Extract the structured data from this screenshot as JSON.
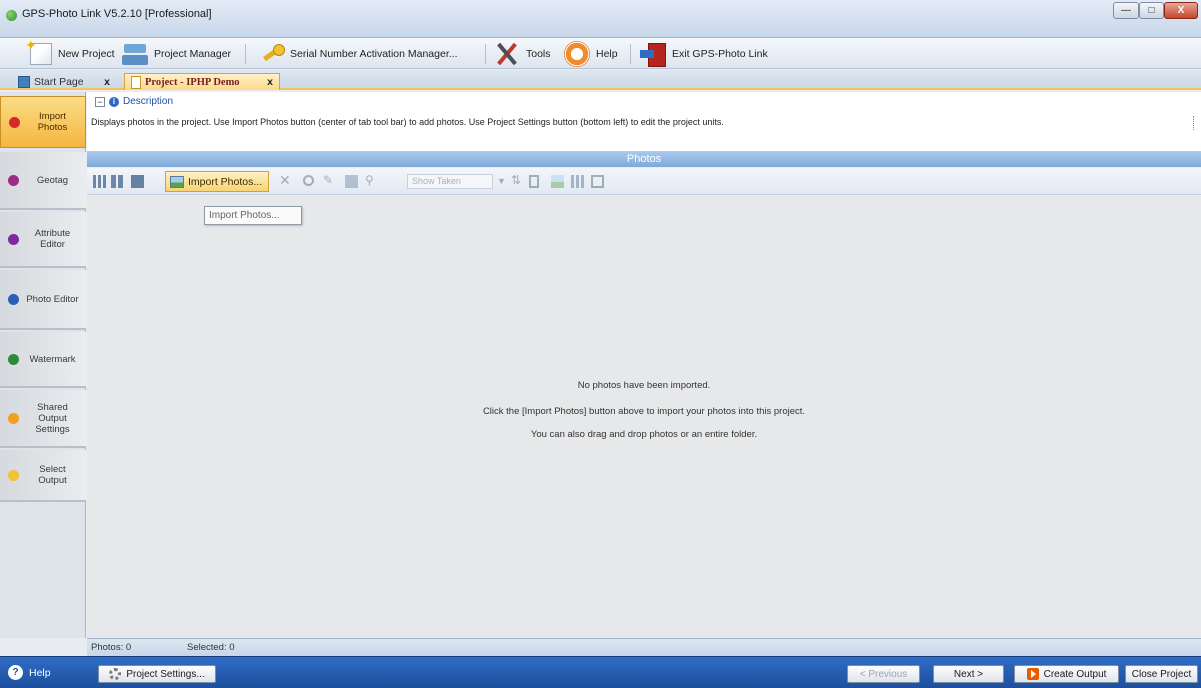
{
  "window": {
    "title": "GPS-Photo Link V5.2.10 [Professional]",
    "controls": {
      "minimize": "—",
      "maximize": "□",
      "close": "X"
    }
  },
  "toolbar": {
    "new_project": "New Project",
    "project_manager": "Project Manager",
    "serial_manager": "Serial Number Activation Manager...",
    "tools": "Tools",
    "help": "Help",
    "exit": "Exit GPS-Photo Link"
  },
  "tabs": {
    "start_page": "Start Page",
    "project": "Project - IPHP Demo",
    "close_glyph": "x"
  },
  "sidenav": {
    "items": [
      {
        "label": "Import Photos",
        "color": "#d8282a",
        "active": true
      },
      {
        "label": "Geotag",
        "color": "#9c2b86"
      },
      {
        "label": "Attribute Editor",
        "color": "#7b2aa0"
      },
      {
        "label": "Photo Editor",
        "color": "#2a5fb8"
      },
      {
        "label": "Watermark",
        "color": "#2e8a3a"
      },
      {
        "label": "Shared Output Settings",
        "color": "#f0a020"
      },
      {
        "label": "Select Output",
        "color": "#f2c230"
      }
    ]
  },
  "description": {
    "header": "Description",
    "collapse": "−",
    "info": "i",
    "text": "Displays photos in the project. Use Import Photos button (center of tab tool bar) to add photos. Use Project Settings button (bottom left) to edit the project units."
  },
  "photos": {
    "header": "Photos",
    "import_button": "Import Photos...",
    "tooltip": "Import Photos...",
    "filter_placeholder": "Show Taken",
    "empty": {
      "line1": "No photos have been imported.",
      "line2": "Click the [Import Photos] button above to import your photos into this project.",
      "line3": "You can also drag and drop photos or an entire folder."
    }
  },
  "status": {
    "photos": "Photos: 0",
    "selected": "Selected: 0"
  },
  "bottom": {
    "help": "Help",
    "project_settings": "Project Settings...",
    "previous": "< Previous",
    "next": "Next >",
    "create_output": "Create Output",
    "close_project": "Close Project"
  },
  "colors": {
    "accent_tab": "#f5b640",
    "bottom_bar": "#1d4f9e",
    "header_blue": "#7fa9da"
  }
}
